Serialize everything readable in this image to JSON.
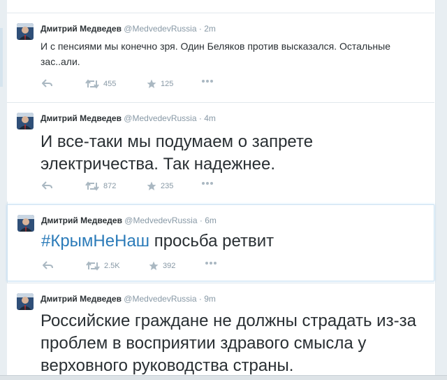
{
  "tweets": [
    {
      "fullname": "Дмитрий Медведев",
      "username": "@MedvedevRussia",
      "separator": "·",
      "time": "2m",
      "text": "И с пенсиями мы конечно зря. Один Беляков против высказался. Остальные зас..али.",
      "retweets": "455",
      "favorites": "125"
    },
    {
      "fullname": "Дмитрий Медведев",
      "username": "@MedvedevRussia",
      "separator": "·",
      "time": "4m",
      "text": "И все-таки мы подумаем о запрете электричества. Так надежнее.",
      "retweets": "872",
      "favorites": "235"
    },
    {
      "fullname": "Дмитрий Медведев",
      "username": "@MedvedevRussia",
      "separator": "·",
      "time": "6m",
      "hashtag": "#КрымНеНаш",
      "text": " просьба ретвит",
      "retweets": "2.5K",
      "favorites": "392"
    },
    {
      "fullname": "Дмитрий Медведев",
      "username": "@MedvedevRussia",
      "separator": "·",
      "time": "9m",
      "text": "Российские граждане не должны страдать из-за проблем в восприятии здравого смысла у верховного руководства страны."
    }
  ],
  "colors": {
    "accent": "#55acee",
    "hashtag": "#2b7bb9",
    "muted": "#8899a6",
    "text": "#292f33"
  },
  "icons": [
    "reply-icon",
    "retweet-icon",
    "favorite-icon",
    "more-icon"
  ]
}
